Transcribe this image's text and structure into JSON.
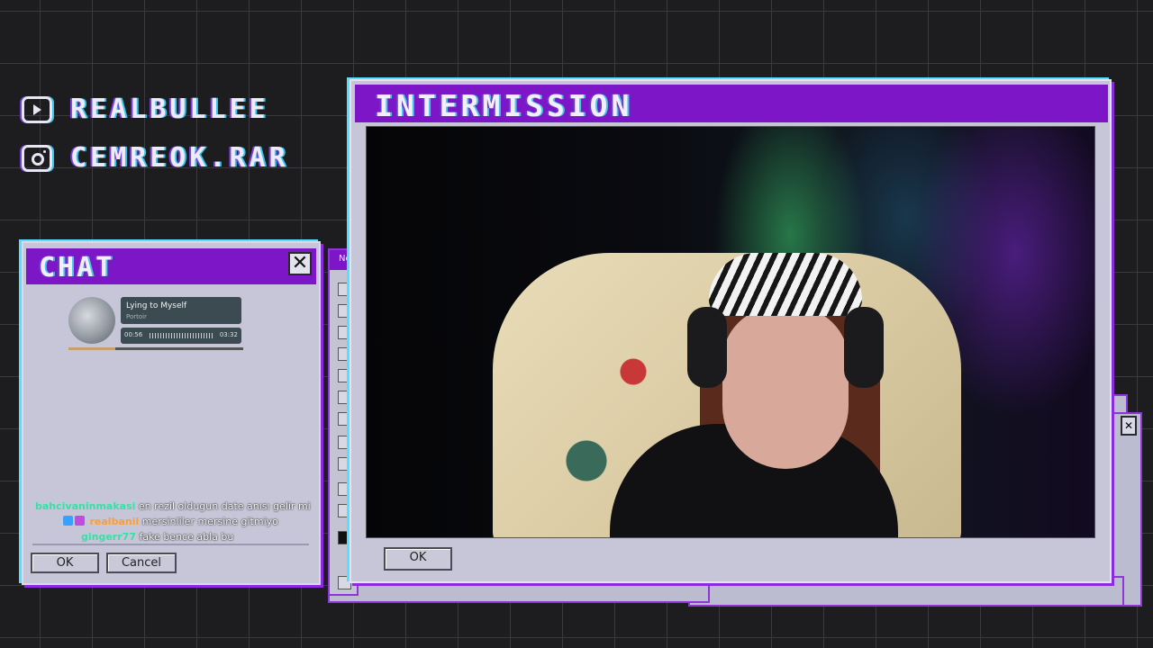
{
  "socials": [
    {
      "icon": "youtube-icon",
      "handle": "REALBULLEE"
    },
    {
      "icon": "instagram-icon",
      "handle": "CEMREOK.RAR"
    }
  ],
  "chat_window": {
    "title": "CHAT",
    "close_glyph": "✕",
    "now_playing": {
      "track": "Lying to Myself",
      "artist": "Portoir",
      "elapsed": "00:56",
      "duration": "03:32",
      "progress_fraction": 0.27
    },
    "messages": [
      {
        "user": "bahcivaninmakasi",
        "user_color": "#37e0a6",
        "text": "en rezil oldugun date anısı gelir mi",
        "badges": []
      },
      {
        "user": "realbanil",
        "user_color": "#ff9d2e",
        "text": "mersinliler mersine gitmiyo",
        "badges": [
          "#3aa0ff",
          "#c04be0"
        ]
      },
      {
        "user": "gingerr77",
        "user_color": "#37e0a6",
        "text": "fake bence abla bu",
        "badges": []
      }
    ],
    "ok_label": "OK",
    "cancel_label": "Cancel"
  },
  "tool_window": {
    "title_fragment": "Ne"
  },
  "main_window": {
    "title": "INTERMISSION",
    "ok_label": "OK"
  },
  "colors": {
    "title_bar": "#7d16c6",
    "window_face": "#c6c6d8",
    "glow_cyan": "#56e0ff",
    "glow_purple": "#8b2ae0"
  }
}
